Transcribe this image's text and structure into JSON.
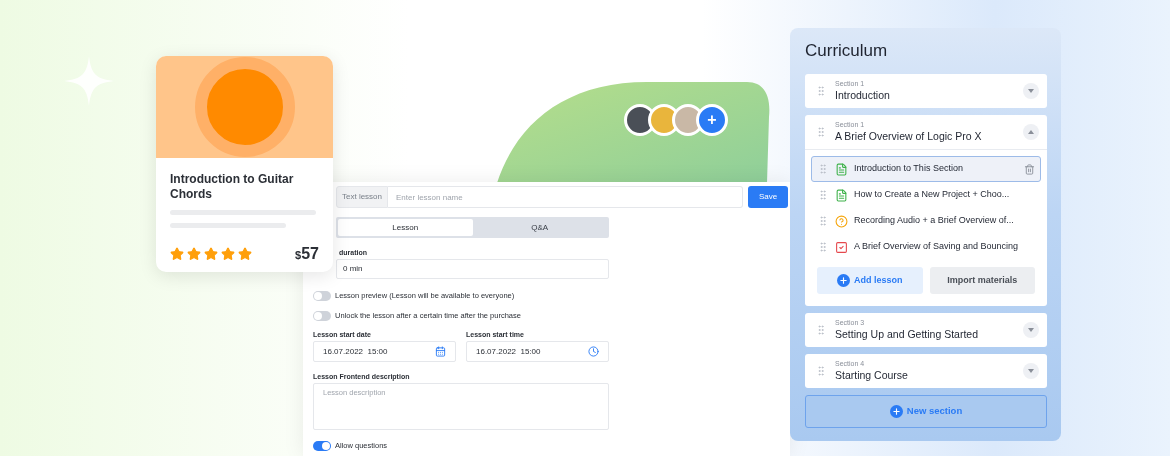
{
  "course_card": {
    "title": "Introduction to Guitar Chords",
    "stars": 5,
    "currency": "$",
    "price": "57"
  },
  "avatars": [
    {
      "kind": "photo"
    },
    {
      "kind": "photo"
    },
    {
      "kind": "photo"
    },
    {
      "kind": "add",
      "label": "+"
    }
  ],
  "lesson_form": {
    "type_label": "Text lesson",
    "name_field": {
      "placeholder": "Enter lesson name"
    },
    "save_button": "Save",
    "tabs": [
      {
        "label": "Lesson",
        "selected": true
      },
      {
        "label": "Q&A",
        "selected": false
      }
    ],
    "duration": {
      "label": "duration",
      "value": "0 min"
    },
    "toggles": [
      {
        "label": "Lesson preview (Lesson will be available to everyone)",
        "on": false
      },
      {
        "label": "Unlock the lesson after a certain time after the purchase",
        "on": false
      }
    ],
    "start_date": {
      "label": "Lesson start date",
      "value": "16.07.2022  15:00"
    },
    "start_time": {
      "label": "Lesson start time",
      "value": "16.07.2022  15:00"
    },
    "description": {
      "label": "Lesson Frontend description",
      "placeholder": "Lesson description"
    },
    "allow_questions": {
      "label": "Allow questions",
      "on": true
    }
  },
  "curriculum": {
    "title": "Curriculum",
    "sections": [
      {
        "number": "Section 1",
        "title": "Introduction",
        "expanded": false
      },
      {
        "number": "Section 1",
        "title": "A Brief Overview of Logic Pro X",
        "expanded": true,
        "lessons": [
          {
            "kind": "text",
            "title": "Introduction to This Section",
            "selected": true
          },
          {
            "kind": "text",
            "title": "How to Create a New Project + Choo...",
            "selected": false
          },
          {
            "kind": "quiz",
            "title": "Recording Audio + a Brief Overview of...",
            "selected": false
          },
          {
            "kind": "assignment",
            "title": "A Brief Overview of Saving and Bouncing",
            "selected": false
          }
        ],
        "add_button": "Add lesson",
        "import_button": "Import materials"
      },
      {
        "number": "Section 3",
        "title": "Setting Up and Getting Started",
        "expanded": false
      },
      {
        "number": "Section 4",
        "title": "Starting Course",
        "expanded": false
      }
    ],
    "new_section_button": "New section"
  }
}
